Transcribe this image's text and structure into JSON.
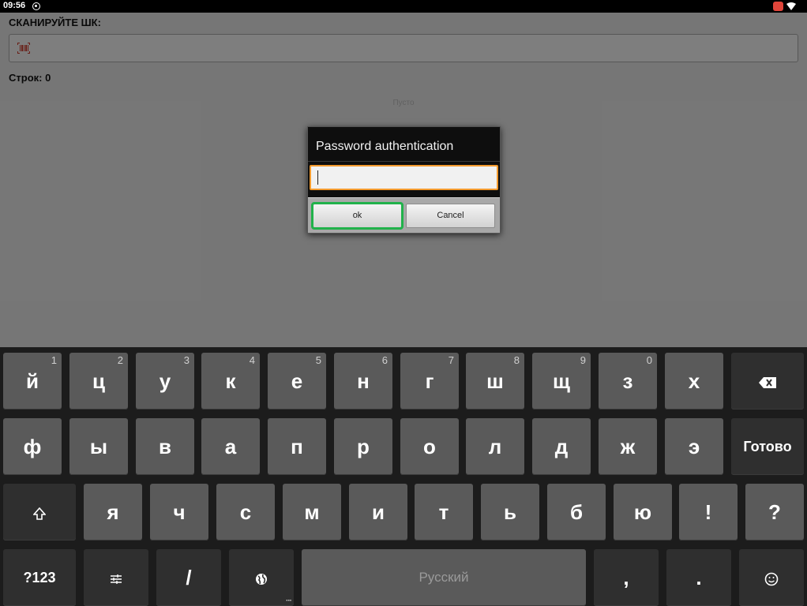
{
  "status_bar": {
    "time": "09:56"
  },
  "app": {
    "scan_label": "СКАНИРУЙТЕ ШК:",
    "scan_placeholder": "",
    "rows_label": "Строк: 0",
    "empty_label": "Пусто"
  },
  "dialog": {
    "title": "Password authentication",
    "password_value": "",
    "ok_label": "ok",
    "cancel_label": "Cancel"
  },
  "keyboard": {
    "row1": [
      {
        "label": "й",
        "hint": "1"
      },
      {
        "label": "ц",
        "hint": "2"
      },
      {
        "label": "у",
        "hint": "3"
      },
      {
        "label": "к",
        "hint": "4"
      },
      {
        "label": "е",
        "hint": "5"
      },
      {
        "label": "н",
        "hint": "6"
      },
      {
        "label": "г",
        "hint": "7"
      },
      {
        "label": "ш",
        "hint": "8"
      },
      {
        "label": "щ",
        "hint": "9"
      },
      {
        "label": "з",
        "hint": "0"
      },
      {
        "label": "х",
        "hint": ""
      }
    ],
    "row2": [
      "ф",
      "ы",
      "в",
      "а",
      "п",
      "р",
      "о",
      "л",
      "д",
      "ж",
      "э"
    ],
    "done_label": "Готово",
    "row3": [
      "я",
      "ч",
      "с",
      "м",
      "и",
      "т",
      "ь",
      "б",
      "ю",
      "!",
      "?"
    ],
    "symbols_label": "?123",
    "slash_label": "/",
    "space_label": "Русский",
    "comma_label": ",",
    "period_label": "."
  },
  "colors": {
    "focus_outline": "#21b24b",
    "input_focus": "#f39a2d"
  }
}
